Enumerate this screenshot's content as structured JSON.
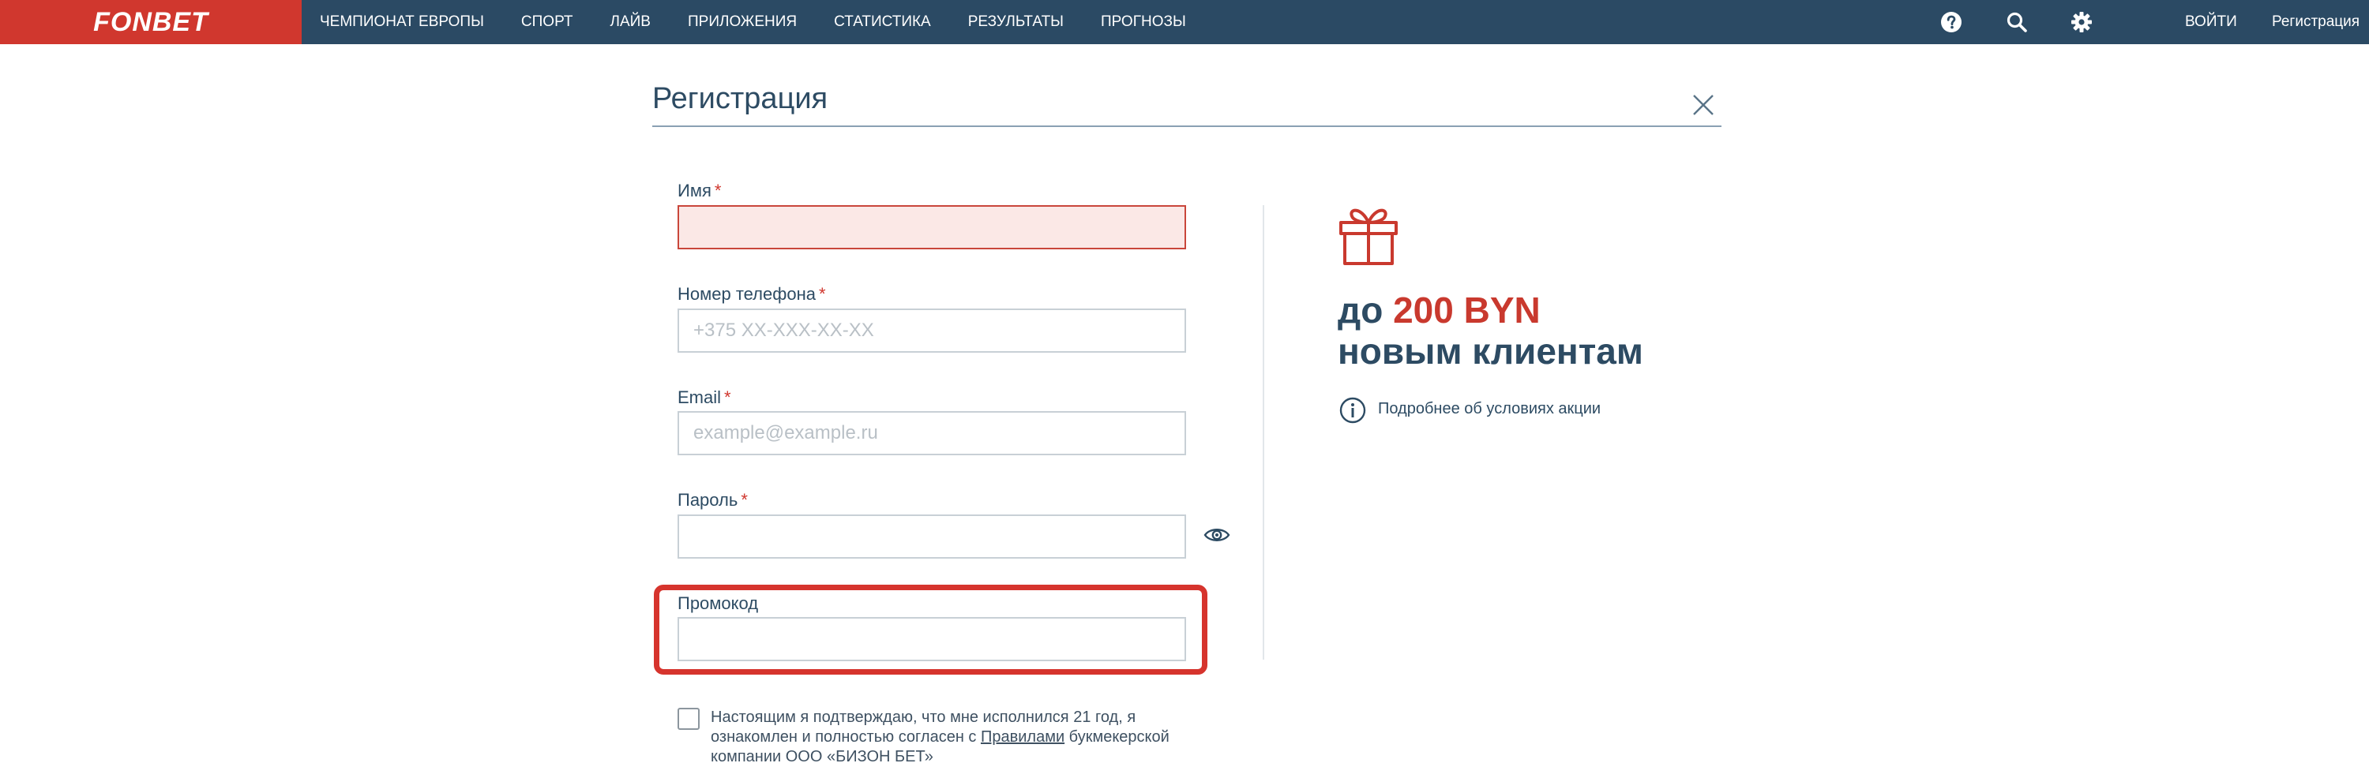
{
  "header": {
    "logo": "FONBET",
    "nav": [
      {
        "label": "ЧЕМПИОНАТ ЕВРОПЫ"
      },
      {
        "label": "СПОРТ"
      },
      {
        "label": "ЛАЙВ"
      },
      {
        "label": "ПРИЛОЖЕНИЯ"
      },
      {
        "label": "СТАТИСТИКА"
      },
      {
        "label": "РЕЗУЛЬТАТЫ"
      },
      {
        "label": "ПРОГНОЗЫ"
      }
    ],
    "login_label": "ВОЙТИ",
    "register_label": "Регистрация",
    "icons": [
      "help-icon",
      "search-icon",
      "gear-icon"
    ]
  },
  "form": {
    "title": "Регистрация",
    "required_mark": "*",
    "fields": {
      "name": {
        "label": "Имя",
        "value": "",
        "placeholder": ""
      },
      "phone": {
        "label": "Номер телефона",
        "value": "",
        "placeholder": "+375 XX-XXX-XX-XX"
      },
      "email": {
        "label": "Email",
        "value": "",
        "placeholder": "example@example.ru"
      },
      "password": {
        "label": "Пароль",
        "value": "",
        "placeholder": ""
      },
      "promo": {
        "label": "Промокод",
        "value": "",
        "placeholder": ""
      }
    },
    "consent": {
      "text_before": "Настоящим я подтверждаю, что мне исполнился 21 год, я ознакомлен и полностью согласен с ",
      "link": "Правилами",
      "text_after": " букмекерской компании ООО «БИЗОН БЕТ»",
      "checked": false
    }
  },
  "promo": {
    "prefix": "до ",
    "amount": "200 BYN",
    "line2": "новым клиентам",
    "info_link": "Подробнее об условиях акции"
  },
  "colors": {
    "header_bg": "#2b4a64",
    "logo_bg": "#d0372e",
    "accent_red": "#c9392e",
    "text": "#2d4b63",
    "error_field_bg": "#fbe8e6"
  }
}
